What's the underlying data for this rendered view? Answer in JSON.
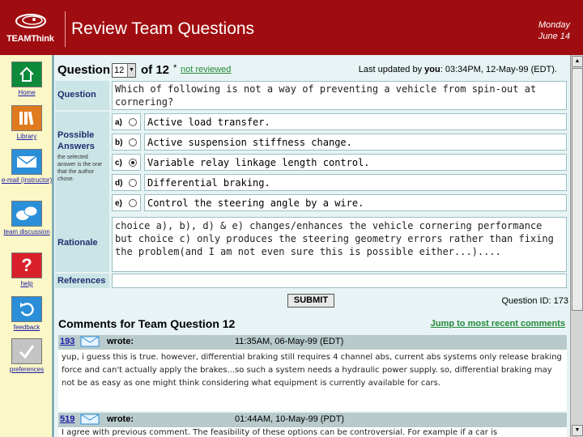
{
  "header": {
    "logo_text": "TEAMThink",
    "title": "Review Team Questions",
    "date_day": "Monday",
    "date_date": "June 14"
  },
  "sidebar": {
    "items": [
      {
        "label": "Home",
        "icon": "home-icon",
        "color": "#0d8a3a"
      },
      {
        "label": "Library",
        "icon": "library-icon",
        "color": "#e07a1f"
      },
      {
        "label": "e-mail (instructor)",
        "icon": "envelope-icon",
        "color": "#2a8ed8"
      },
      {
        "label": "team discussion",
        "icon": "chat-bubbles-icon",
        "color": "#2a8ed8"
      },
      {
        "label": "help",
        "icon": "question-icon",
        "color": "#d8202a"
      },
      {
        "label": "feedback",
        "icon": "refresh-arrow-icon",
        "color": "#2a8ed8"
      },
      {
        "label": "preferences",
        "icon": "checkmark-icon",
        "color": "#aaaaaa"
      }
    ]
  },
  "question_bar": {
    "label": "Question",
    "selected": "12",
    "of_total": "of 12",
    "star": "*",
    "status": "not reviewed",
    "updated_prefix": "Last updated by",
    "updated_by": "you",
    "updated_time": ": 03:34PM, 12-May-99 (EDT)."
  },
  "question": {
    "label": "Question",
    "text": "Which of following is not a way of preventing a vehicle from spin-out at cornering?"
  },
  "answers": {
    "label": "Possible Answers",
    "note": "the selected answer is the one that the author chose.",
    "items": [
      {
        "letter": "a)",
        "text": "Active load transfer.",
        "selected": false
      },
      {
        "letter": "b)",
        "text": "Active suspension stiffness change.",
        "selected": false
      },
      {
        "letter": "c)",
        "text": "Variable relay linkage length control.",
        "selected": true
      },
      {
        "letter": "d)",
        "text": "Differential braking.",
        "selected": false
      },
      {
        "letter": "e)",
        "text": "Control the steering angle by a wire.",
        "selected": false
      }
    ]
  },
  "rationale": {
    "label": "Rationale",
    "text": "choice a), b), d) & e) changes/enhances the vehicle cornering performance but choice c) only produces the steering geometry errors rather than fixing the problem(and I am not even sure this is possible either...)...."
  },
  "references": {
    "label": "References",
    "text": ""
  },
  "submit_label": "SUBMIT",
  "question_id": "Question ID: 173",
  "comments": {
    "title": "Comments for Team Question 12",
    "jump_link": "Jump to most recent comments",
    "items": [
      {
        "id": "193",
        "wrote": "wrote:",
        "time": "11:35AM, 06-May-99 (EDT)",
        "body": "yup, i guess this is true. however, differential braking still requires 4 channel abs, current abs systems only release braking force and can't actually apply the brakes...so such a system needs a hydraulic power supply. so, differential braking may not be as easy as one might think considering what equipment is currently available for cars."
      },
      {
        "id": "519",
        "wrote": "wrote:",
        "time": "01:44AM, 10-May-99 (PDT)",
        "body": "I agree with previous comment. The feasibility of these options can be controversial. For example if a car is"
      }
    ]
  }
}
